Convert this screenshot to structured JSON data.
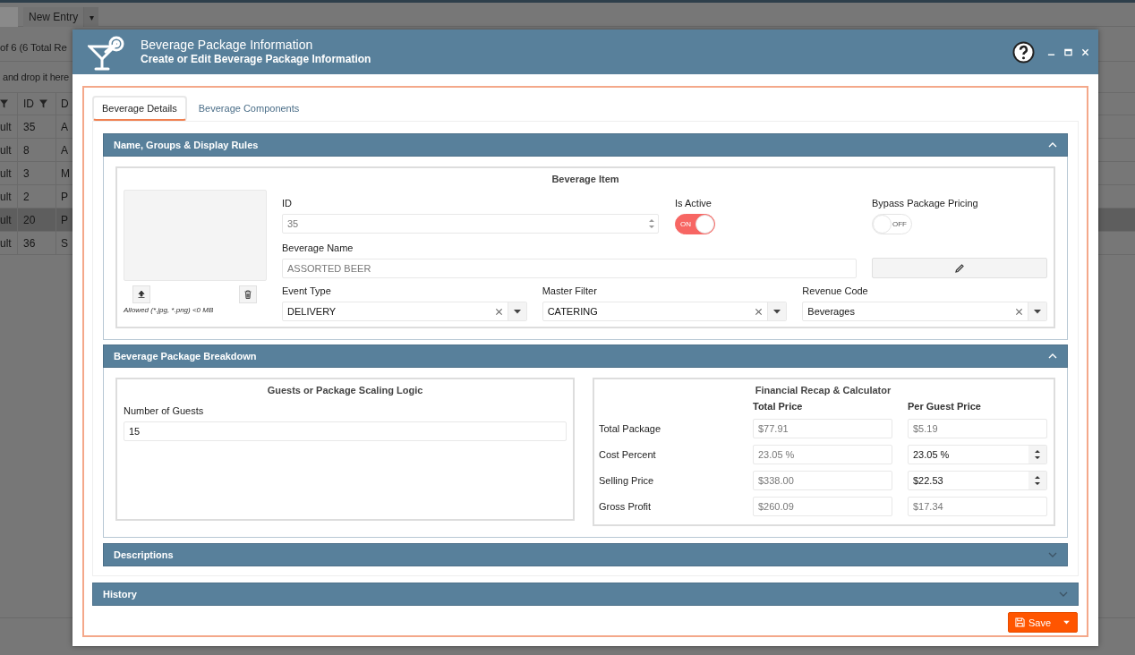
{
  "background": {
    "toolbar": {
      "new_entry": "New Entry",
      "caret": "▾"
    },
    "pager": "of 6 (6 Total Re",
    "group_hint": "and drop it here",
    "grid": {
      "columns": [
        {
          "filter": true
        },
        {
          "label": "ID",
          "filter": true
        },
        {
          "label": "D"
        }
      ],
      "rows": [
        {
          "cells": [
            "ult",
            "35",
            "A"
          ],
          "selected": false
        },
        {
          "cells": [
            "ult",
            "8",
            "A"
          ],
          "selected": false
        },
        {
          "cells": [
            "ult",
            "3",
            "M"
          ],
          "selected": false
        },
        {
          "cells": [
            "ult",
            "2",
            "P"
          ],
          "selected": false
        },
        {
          "cells": [
            "ult",
            "20",
            "P"
          ],
          "selected": true
        },
        {
          "cells": [
            "ult",
            "36",
            "S"
          ],
          "selected": false
        }
      ]
    }
  },
  "dialog": {
    "title": "Beverage Package Information",
    "subtitle": "Create or Edit Beverage Package Information",
    "tabs": [
      {
        "label": "Beverage Details",
        "selected": true
      },
      {
        "label": "Beverage Components",
        "selected": false
      }
    ],
    "sections": [
      {
        "kind": "details",
        "title": "Name, Groups & Display Rules",
        "expanded": true
      },
      {
        "kind": "breakdown",
        "title": "Beverage Package Breakdown",
        "expanded": true
      },
      {
        "kind": "descriptions",
        "title": "Descriptions",
        "expanded": false
      }
    ],
    "beverage_item": {
      "title": "Beverage Item",
      "image_hint": "Allowed (*.jpg, *.png) <0 MB",
      "id": {
        "label": "ID",
        "value": "35"
      },
      "is_active": {
        "label": "Is Active",
        "on": true,
        "text": "ON"
      },
      "bypass": {
        "label": "Bypass Package Pricing",
        "on": false,
        "text": "OFF"
      },
      "name": {
        "label": "Beverage Name",
        "value": "ASSORTED BEER"
      },
      "selects": [
        {
          "label": "Event Type",
          "value": "DELIVERY"
        },
        {
          "label": "Master Filter",
          "value": "CATERING"
        },
        {
          "label": "Revenue Code",
          "value": "Beverages"
        }
      ]
    },
    "guests": {
      "title": "Guests or Package Scaling Logic",
      "label": "Number of Guests",
      "value": "15"
    },
    "financial": {
      "title": "Financial Recap & Calculator",
      "columns": [
        "Total Price",
        "Per Guest Price"
      ],
      "rows": [
        {
          "label": "Total Package",
          "total": "$77.91",
          "per_guest": "$5.19",
          "editable": false
        },
        {
          "label": "Cost Percent",
          "total": "23.05 %",
          "per_guest": "23.05 %",
          "editable": true
        },
        {
          "label": "Selling Price",
          "total": "$338.00",
          "per_guest": "$22.53",
          "editable": true
        },
        {
          "label": "Gross Profit",
          "total": "$260.09",
          "per_guest": "$17.34",
          "editable": false
        }
      ]
    },
    "history": {
      "title": "History",
      "expanded": false
    },
    "save": {
      "label": "Save"
    }
  }
}
